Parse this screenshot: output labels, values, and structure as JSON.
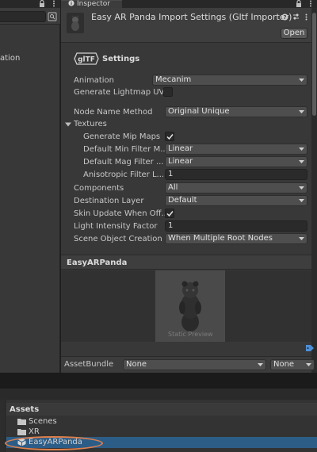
{
  "hierarchy": {
    "row_label_partial": "ation"
  },
  "inspector": {
    "tab_label": "Inspector",
    "title": "Easy AR Panda Import Settings (Gltf Importer)",
    "open_label": "Open",
    "section": {
      "badge": "glTF",
      "title": "Settings"
    },
    "fields": {
      "animation": {
        "label": "Animation",
        "value": "Mecanim"
      },
      "generate_lightmap_uvs": {
        "label": "Generate Lightmap UVs",
        "checked": false
      },
      "node_name_method": {
        "label": "Node Name Method",
        "value": "Original Unique"
      },
      "textures": {
        "label": "Textures",
        "expanded": true
      },
      "generate_mip_maps": {
        "label": "Generate Mip Maps",
        "checked": true
      },
      "default_min_filter": {
        "label": "Default Min Filter M...",
        "value": "Linear"
      },
      "default_mag_filter": {
        "label": "Default Mag Filter ...",
        "value": "Linear"
      },
      "anisotropic_filter": {
        "label": "Anisotropic Filter L...",
        "value": "1"
      },
      "components": {
        "label": "Components",
        "value": "All"
      },
      "destination_layer": {
        "label": "Destination Layer",
        "value": "Default"
      },
      "skin_update": {
        "label": "Skin Update When Off...",
        "checked": true
      },
      "light_intensity": {
        "label": "Light Intensity Factor",
        "value": "1"
      },
      "scene_object_creation": {
        "label": "Scene Object Creation",
        "value": "When Multiple Root Nodes"
      }
    },
    "preview": {
      "title": "EasyARPanda",
      "static_label": "Static Preview"
    },
    "asset_bundle": {
      "label": "AssetBundle",
      "name_value": "None",
      "variant_value": "None"
    }
  },
  "project": {
    "root_label": "Assets",
    "items": [
      {
        "label": "Scenes",
        "icon": "folder-icon"
      },
      {
        "label": "XR",
        "icon": "folder-icon"
      },
      {
        "label": "EasyARPanda",
        "icon": "model-icon",
        "selected": true
      }
    ]
  },
  "colors": {
    "selection": "#2c5d87",
    "highlight_ring": "#e0804c",
    "panel": "#383838"
  }
}
